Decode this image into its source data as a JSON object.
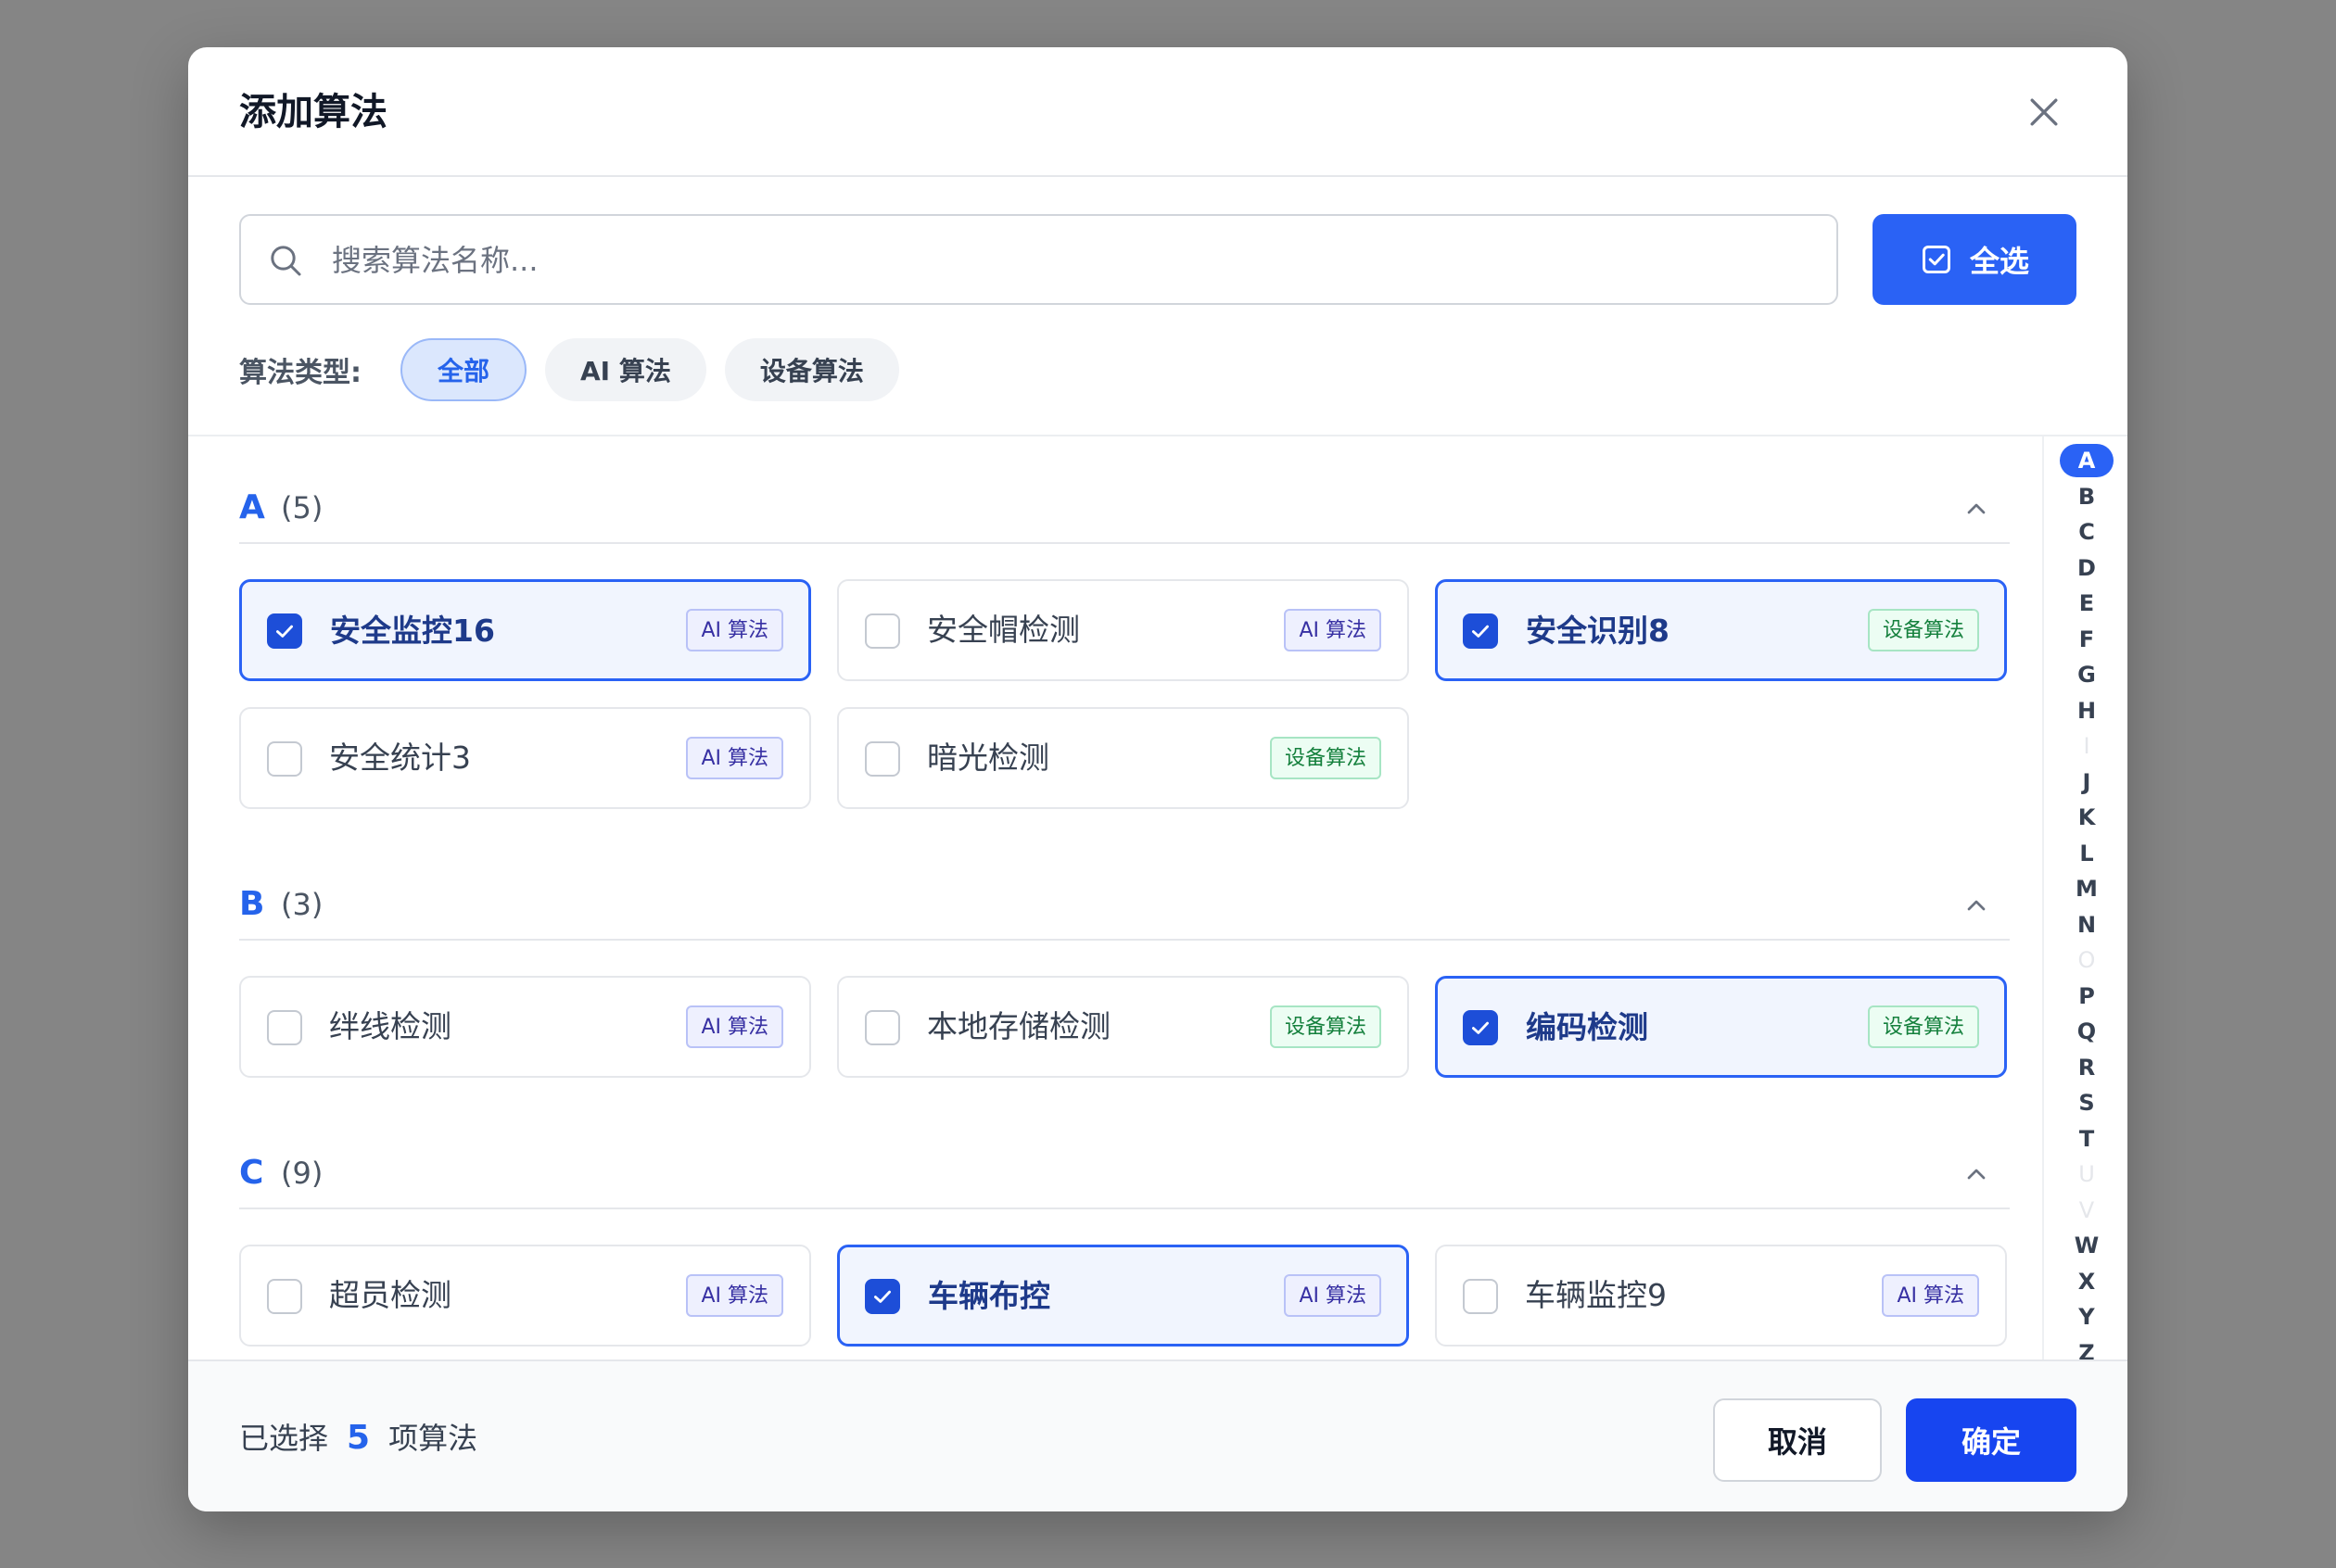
{
  "dialog": {
    "title": "添加算法"
  },
  "search": {
    "placeholder": "搜索算法名称...",
    "value": ""
  },
  "toolbar": {
    "select_all_label": "全选"
  },
  "filter": {
    "label": "算法类型:",
    "options": [
      {
        "label": "全部",
        "active": true
      },
      {
        "label": "AI 算法",
        "active": false
      },
      {
        "label": "设备算法",
        "active": false
      }
    ]
  },
  "groups": [
    {
      "letter": "A",
      "count": "(5)",
      "items": [
        {
          "name": "安全监控16",
          "tag": "AI 算法",
          "type": "ai",
          "selected": true
        },
        {
          "name": "安全帽检测",
          "tag": "AI 算法",
          "type": "ai",
          "selected": false
        },
        {
          "name": "安全识别8",
          "tag": "设备算法",
          "type": "dev",
          "selected": true
        },
        {
          "name": "安全统计3",
          "tag": "AI 算法",
          "type": "ai",
          "selected": false
        },
        {
          "name": "暗光检测",
          "tag": "设备算法",
          "type": "dev",
          "selected": false
        }
      ]
    },
    {
      "letter": "B",
      "count": "(3)",
      "items": [
        {
          "name": "绊线检测",
          "tag": "AI 算法",
          "type": "ai",
          "selected": false
        },
        {
          "name": "本地存储检测",
          "tag": "设备算法",
          "type": "dev",
          "selected": false
        },
        {
          "name": "编码检测",
          "tag": "设备算法",
          "type": "dev",
          "selected": true
        }
      ]
    },
    {
      "letter": "C",
      "count": "(9)",
      "items": [
        {
          "name": "超员检测",
          "tag": "AI 算法",
          "type": "ai",
          "selected": false
        },
        {
          "name": "车辆布控",
          "tag": "AI 算法",
          "type": "ai",
          "selected": true
        },
        {
          "name": "车辆监控9",
          "tag": "AI 算法",
          "type": "ai",
          "selected": false
        }
      ]
    }
  ],
  "alphabet": [
    {
      "l": "A",
      "state": "active"
    },
    {
      "l": "B",
      "state": "on"
    },
    {
      "l": "C",
      "state": "on"
    },
    {
      "l": "D",
      "state": "on"
    },
    {
      "l": "E",
      "state": "on"
    },
    {
      "l": "F",
      "state": "on"
    },
    {
      "l": "G",
      "state": "on"
    },
    {
      "l": "H",
      "state": "on"
    },
    {
      "l": "I",
      "state": "off"
    },
    {
      "l": "J",
      "state": "on"
    },
    {
      "l": "K",
      "state": "on"
    },
    {
      "l": "L",
      "state": "on"
    },
    {
      "l": "M",
      "state": "on"
    },
    {
      "l": "N",
      "state": "on"
    },
    {
      "l": "O",
      "state": "off"
    },
    {
      "l": "P",
      "state": "on"
    },
    {
      "l": "Q",
      "state": "on"
    },
    {
      "l": "R",
      "state": "on"
    },
    {
      "l": "S",
      "state": "on"
    },
    {
      "l": "T",
      "state": "on"
    },
    {
      "l": "U",
      "state": "off"
    },
    {
      "l": "V",
      "state": "off"
    },
    {
      "l": "W",
      "state": "on"
    },
    {
      "l": "X",
      "state": "on"
    },
    {
      "l": "Y",
      "state": "on"
    },
    {
      "l": "Z",
      "state": "on"
    }
  ],
  "footer": {
    "selected_prefix": "已选择",
    "selected_count": "5",
    "selected_suffix": "项算法",
    "cancel_label": "取消",
    "ok_label": "确定"
  },
  "colors": {
    "accent": "#2a62f5",
    "ok_button": "#1745f0",
    "ai_tag": "#3730a3",
    "device_tag": "#15803d"
  }
}
